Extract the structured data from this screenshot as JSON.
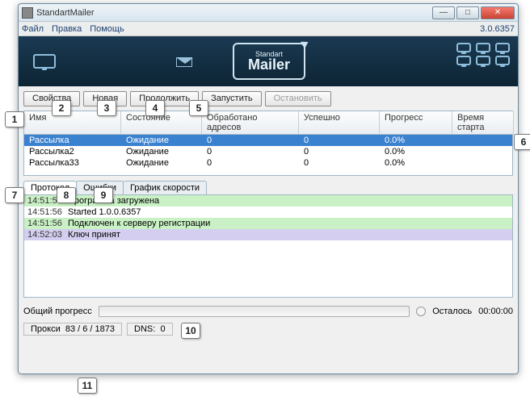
{
  "window": {
    "title": "StandartMailer"
  },
  "version": "3.0.6357",
  "menu": {
    "file": "Файл",
    "edit": "Правка",
    "help": "Помощь"
  },
  "logo": {
    "top": "Standart",
    "main": "Mailer"
  },
  "toolbar": {
    "properties": "Свойства",
    "new": "Новая",
    "continue": "Продолжить",
    "start": "Запустить",
    "stop": "Остановить"
  },
  "columns": {
    "name": "Имя",
    "state": "Состояние",
    "addresses": "Обработано адресов",
    "success": "Успешно",
    "progress": "Прогресс",
    "start_time": "Время старта"
  },
  "rows": [
    {
      "name": "Рассылка",
      "state": "Ожидание",
      "addresses": "0",
      "success": "0",
      "progress": "0.0%",
      "start_time": ""
    },
    {
      "name": "Рассылка2",
      "state": "Ожидание",
      "addresses": "0",
      "success": "0",
      "progress": "0.0%",
      "start_time": ""
    },
    {
      "name": "Рассылка33",
      "state": "Ожидание",
      "addresses": "0",
      "success": "0",
      "progress": "0.0%",
      "start_time": ""
    }
  ],
  "tabs": {
    "protocol": "Протокол",
    "errors": "Ошибки",
    "speed": "График скорости"
  },
  "log": [
    {
      "time": "14:51:56",
      "msg": "Программа загружена",
      "cls": "lg-green"
    },
    {
      "time": "14:51:56",
      "msg": "Started 1.0.0.6357",
      "cls": "lg-white"
    },
    {
      "time": "14:51:56",
      "msg": "Подключен к серверу регистрации",
      "cls": "lg-green"
    },
    {
      "time": "14:52:03",
      "msg": "Ключ принят",
      "cls": "lg-purple"
    }
  ],
  "progress": {
    "label": "Общий прогресс",
    "remaining_label": "Осталось",
    "remaining_value": "00:00:00"
  },
  "status": {
    "proxy_label": "Прокси",
    "proxy_value": "83 / 6 / 1873",
    "dns_label": "DNS:",
    "dns_value": "0"
  },
  "callouts": [
    "1",
    "2",
    "3",
    "4",
    "5",
    "6",
    "7",
    "8",
    "9",
    "10",
    "11"
  ]
}
